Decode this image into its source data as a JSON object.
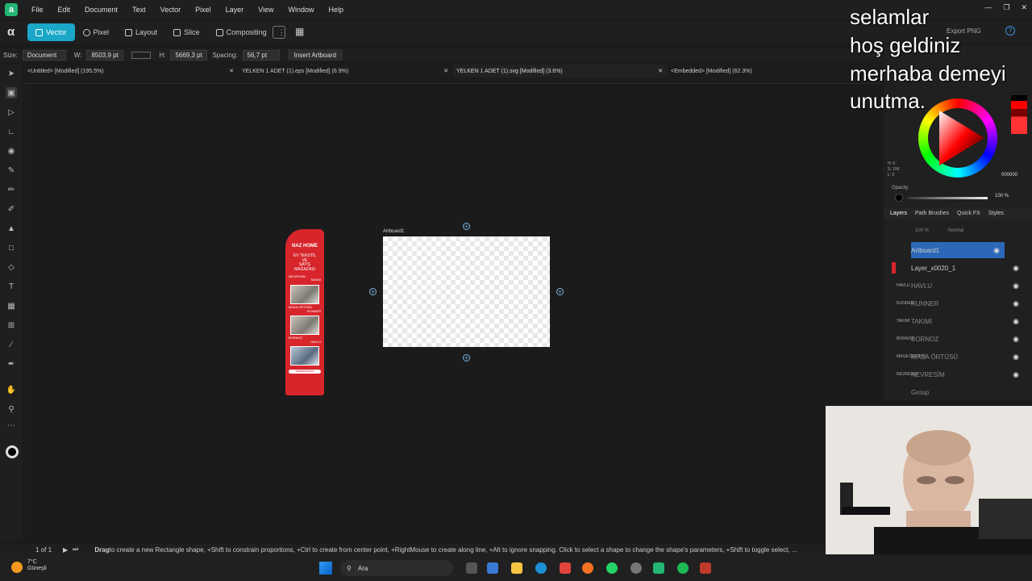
{
  "menu": [
    "File",
    "Edit",
    "Document",
    "Text",
    "Vector",
    "Pixel",
    "Layer",
    "View",
    "Window",
    "Help"
  ],
  "personas": [
    "Vector",
    "Pixel",
    "Layout",
    "Slice",
    "Compositing"
  ],
  "export_label": "Export PNG",
  "context": {
    "size_label": "Size:",
    "size_value": "Document",
    "w_label": "W:",
    "w_value": "8503,9 pt",
    "h_label": "H:",
    "h_value": "5669,3 pt",
    "spacing_label": "Spacing:",
    "spacing_value": "56,7 pt",
    "insert_btn": "Insert Artboard"
  },
  "tabs": [
    "<Untitled> [Modified] (195.5%)",
    "YELKEN 1 ADET (1).eps [Modified] (6.9%)",
    "YELKEN 1 ADET (1).svg [Modified] (3.6%)",
    "<Embedded> [Modified] (62.3%)"
  ],
  "banner": {
    "brand": "NAZ HOME",
    "line1": "EV TEKSTİL",
    "line2": "VE",
    "line3": "SATIŞ",
    "line4": "MAĞAZASI",
    "p1a": "NEVRESİM",
    "p1b": "TAKIMI",
    "p2a": "MASA ÖRTÜSÜ",
    "p2b": "RUNNER",
    "p3a": "BORNOZ",
    "p3b": "HAVLU",
    "social": "tasknbehone"
  },
  "artboard_label": "Artboard1",
  "color": {
    "h": "H: 0",
    "s": "S: 100",
    "l": "L: 0",
    "hex": "000000",
    "opacity_label": "Opacity",
    "opacity_value": "100 %"
  },
  "right_tabs": [
    "Layers",
    "Path Brushes",
    "Quick FX",
    "Styles"
  ],
  "layer_opts": {
    "opacity": "100 %",
    "blend": "Normal"
  },
  "layers": [
    {
      "tag": "",
      "name": "Artboard1"
    },
    {
      "tag": "",
      "name": "Layer_x0020_1"
    },
    {
      "tag": "HAVLU",
      "name": "HAVLU"
    },
    {
      "tag": "RUNNER",
      "name": "RUNNER"
    },
    {
      "tag": "TAKIMI",
      "name": "TAKIMI"
    },
    {
      "tag": "BORNOZ",
      "name": "BORNOZ"
    },
    {
      "tag": "MASA ÖRTÜSÜ",
      "name": "MASA ÖRTÜSÜ"
    },
    {
      "tag": "NEVRESİM",
      "name": "NEVRESİM"
    },
    {
      "tag": "",
      "name": "Group"
    }
  ],
  "overlay_lines": [
    "selamlar",
    "hoş geldiniz",
    "merhaba demeyi",
    "unutma."
  ],
  "status": {
    "page": "1 of 1",
    "hint_prefix": "Drag",
    "hint": " to create a new Rectangle shape, +Shift to constrain proportions, +Ctrl to create from center point, +RightMouse to create along line, +Alt to ignore snapping. Click to select a shape to change the shape's parameters, +Shift to toggle select, ..."
  },
  "taskbar": {
    "temp": "7°C",
    "weather": "Güneşli",
    "search": "Ara"
  },
  "colors": {
    "accent": "#1aa7c8",
    "selection": "#2b68b8",
    "banner_red": "#d7252b"
  }
}
